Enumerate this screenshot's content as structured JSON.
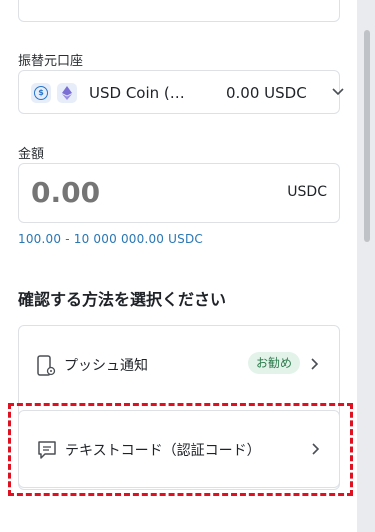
{
  "form": {
    "account_label": "振替元口座",
    "account_select": {
      "name": "USD Coin (…",
      "amount": "0.00 USDC",
      "icons": [
        "usd-coin-icon",
        "ethereum-icon"
      ]
    },
    "amount_label": "金額",
    "amount_input": {
      "value": "0.00",
      "unit": "USDC"
    },
    "range_text": "100.00 - 10 000 000.00 USDC"
  },
  "verification": {
    "title": "確認する方法を選択ください",
    "methods": [
      {
        "label": "プッシュ通知",
        "badge": "お勧め",
        "icon": "phone-notification-icon"
      },
      {
        "label": "テキストコード（認証コード）",
        "icon": "message-icon"
      }
    ]
  },
  "colors": {
    "accent_link": "#2a77b4",
    "badge_bg": "#e3f3ea",
    "badge_text": "#2b7a4b",
    "highlight": "#e01020"
  }
}
